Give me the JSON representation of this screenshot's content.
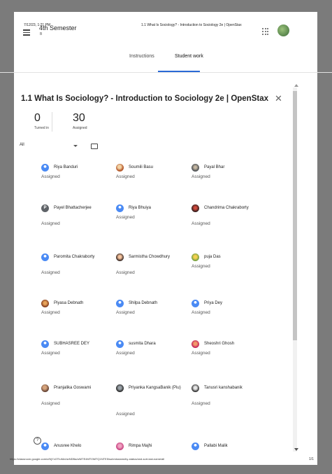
{
  "print_header": {
    "timestamp": "7/12/23, 1:21 PM",
    "page_title": "1.1 What Is Sociology? - Introduction to Sociology 2e | OpenStax"
  },
  "print_footer": {
    "url": "https://classroom.google.com/c/NjYxOTIoMzUwNDBa/a/MTE4MTI3MTQ1NTE5/submissions/by-status/and-sort-last-name/all",
    "page": "1/1"
  },
  "course": {
    "name": "4th Semester",
    "section": "B"
  },
  "tabs": [
    {
      "label": "Instructions"
    },
    {
      "label": "Student work"
    }
  ],
  "assignment": {
    "title": "1.1 What Is Sociology? - Introduction to Sociology 2e | OpenStax",
    "close_icon": "close-icon"
  },
  "counts": {
    "turned_in": {
      "value": "0",
      "label": "Turned in"
    },
    "assigned": {
      "value": "30",
      "label": "Assigned"
    }
  },
  "filter": {
    "selected": "All"
  },
  "students": [
    {
      "name": "Riya Banduri",
      "status": "Assigned",
      "avatar": "blue"
    },
    {
      "name": "Soumili Basu",
      "status": "Assigned",
      "avatar": "photo1"
    },
    {
      "name": "Payal Bhar",
      "status": "Assigned",
      "avatar": "photo2"
    },
    {
      "name": "Payel Bhattacherjee",
      "status": "Assigned",
      "avatar": "letter",
      "initial": "P"
    },
    {
      "name": "Riya Bhuiya",
      "status": "Assigned",
      "avatar": "blue"
    },
    {
      "name": "Chandrima Chakraborty",
      "status": "Assigned",
      "avatar": "photo3"
    },
    {
      "name": "Paromita Chakraborty",
      "status": "Assigned",
      "avatar": "blue"
    },
    {
      "name": "Sarmistha Chowdhury",
      "status": "Assigned",
      "avatar": "photo4"
    },
    {
      "name": "puja Das",
      "status": "Assigned",
      "avatar": "photo5"
    },
    {
      "name": "Piyasa Debnath",
      "status": "Assigned",
      "avatar": "photo6"
    },
    {
      "name": "Shilpa Debnath",
      "status": "Assigned",
      "avatar": "blue"
    },
    {
      "name": "Priya Dey",
      "status": "Assigned",
      "avatar": "blue"
    },
    {
      "name": "SUBHASREE DEY",
      "status": "Assigned",
      "avatar": "blue"
    },
    {
      "name": "susmita Dhara",
      "status": "Assigned",
      "avatar": "blue"
    },
    {
      "name": "Sheoshri Ghosh",
      "status": "Assigned",
      "avatar": "photo7"
    },
    {
      "name": "Pranjalika Goswami",
      "status": "Assigned",
      "avatar": "photo8"
    },
    {
      "name": "Priyanka KangsaBanik (Piu)",
      "status": "Assigned",
      "avatar": "photo9"
    },
    {
      "name": "Tanusri kanshabanik",
      "status": "Assigned",
      "avatar": "photo10"
    },
    {
      "name": "Anusree Khelo",
      "status": "",
      "avatar": "blue"
    },
    {
      "name": "Rimpa Majhi",
      "status": "",
      "avatar": "photo11"
    },
    {
      "name": "Pallabi Malik",
      "status": "",
      "avatar": "blue"
    }
  ],
  "colors": {
    "accent": "#2a6ad6",
    "default_avatar": "#4a8af4"
  }
}
